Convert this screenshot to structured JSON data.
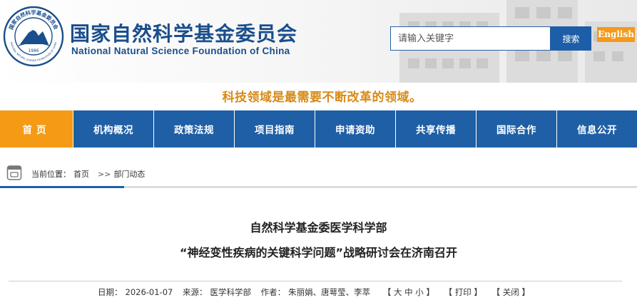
{
  "header": {
    "logo": {
      "ring_text": "国家自然科学基金委员会",
      "ring_text_en": "NATIONAL NATURAL SCIENCE FOUNDATION OF CHINA",
      "year": "1986"
    },
    "title": "国家自然科学基金委员会",
    "subtitle": "National Natural Science Foundation of China",
    "search": {
      "placeholder": "请输入关键字",
      "button_label": "搜索"
    },
    "english_label": "English"
  },
  "slogan": "科技领域是最需要不断改革的领域。",
  "nav": {
    "items": [
      {
        "label": "首页",
        "active": true
      },
      {
        "label": "机构概况",
        "active": false
      },
      {
        "label": "政策法规",
        "active": false
      },
      {
        "label": "项目指南",
        "active": false
      },
      {
        "label": "申请资助",
        "active": false
      },
      {
        "label": "共享传播",
        "active": false
      },
      {
        "label": "国际合作",
        "active": false
      },
      {
        "label": "信息公开",
        "active": false
      }
    ]
  },
  "breadcrumb": {
    "prefix": "当前位置：",
    "home": "首页",
    "separator": ">>",
    "current": "部门动态"
  },
  "article": {
    "title_line1": "自然科学基金委医学科学部",
    "title_line2": "“神经变性疾病的关键科学问题”战略研讨会在济南召开",
    "date_label": "日期：",
    "date": "2026-01-07",
    "source_label": "来源：",
    "source": "医学科学部",
    "author_label": "作者：",
    "authors": "朱丽娟、唐萼莹、李萃",
    "font_size": {
      "open": "【",
      "large": "大",
      "medium": "中",
      "small": "小",
      "close": "】"
    },
    "print_label": "【 打印 】",
    "close_label": "【 关闭 】"
  },
  "colors": {
    "brand_blue": "#1e5fa6",
    "accent_orange": "#f59a15",
    "slogan_gold": "#d88a16"
  }
}
